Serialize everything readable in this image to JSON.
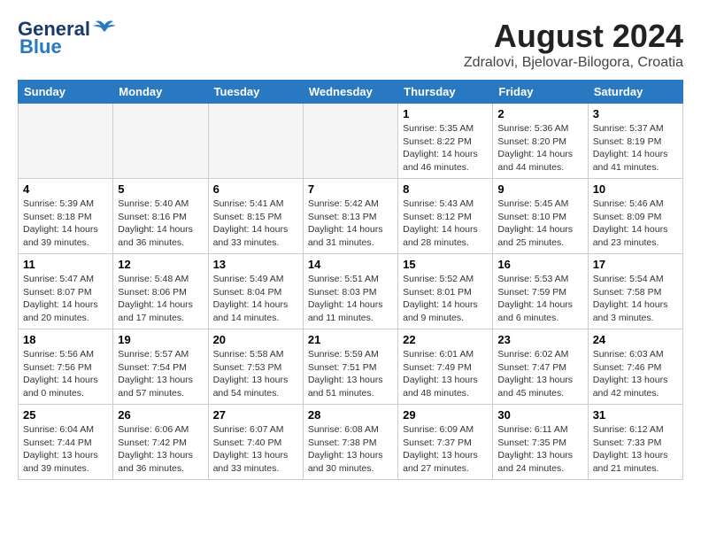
{
  "header": {
    "logo_general": "General",
    "logo_blue": "Blue",
    "month_year": "August 2024",
    "location": "Zdralovi, Bjelovar-Bilogora, Croatia"
  },
  "weekdays": [
    "Sunday",
    "Monday",
    "Tuesday",
    "Wednesday",
    "Thursday",
    "Friday",
    "Saturday"
  ],
  "weeks": [
    [
      {
        "day": "",
        "info": ""
      },
      {
        "day": "",
        "info": ""
      },
      {
        "day": "",
        "info": ""
      },
      {
        "day": "",
        "info": ""
      },
      {
        "day": "1",
        "info": "Sunrise: 5:35 AM\nSunset: 8:22 PM\nDaylight: 14 hours\nand 46 minutes."
      },
      {
        "day": "2",
        "info": "Sunrise: 5:36 AM\nSunset: 8:20 PM\nDaylight: 14 hours\nand 44 minutes."
      },
      {
        "day": "3",
        "info": "Sunrise: 5:37 AM\nSunset: 8:19 PM\nDaylight: 14 hours\nand 41 minutes."
      }
    ],
    [
      {
        "day": "4",
        "info": "Sunrise: 5:39 AM\nSunset: 8:18 PM\nDaylight: 14 hours\nand 39 minutes."
      },
      {
        "day": "5",
        "info": "Sunrise: 5:40 AM\nSunset: 8:16 PM\nDaylight: 14 hours\nand 36 minutes."
      },
      {
        "day": "6",
        "info": "Sunrise: 5:41 AM\nSunset: 8:15 PM\nDaylight: 14 hours\nand 33 minutes."
      },
      {
        "day": "7",
        "info": "Sunrise: 5:42 AM\nSunset: 8:13 PM\nDaylight: 14 hours\nand 31 minutes."
      },
      {
        "day": "8",
        "info": "Sunrise: 5:43 AM\nSunset: 8:12 PM\nDaylight: 14 hours\nand 28 minutes."
      },
      {
        "day": "9",
        "info": "Sunrise: 5:45 AM\nSunset: 8:10 PM\nDaylight: 14 hours\nand 25 minutes."
      },
      {
        "day": "10",
        "info": "Sunrise: 5:46 AM\nSunset: 8:09 PM\nDaylight: 14 hours\nand 23 minutes."
      }
    ],
    [
      {
        "day": "11",
        "info": "Sunrise: 5:47 AM\nSunset: 8:07 PM\nDaylight: 14 hours\nand 20 minutes."
      },
      {
        "day": "12",
        "info": "Sunrise: 5:48 AM\nSunset: 8:06 PM\nDaylight: 14 hours\nand 17 minutes."
      },
      {
        "day": "13",
        "info": "Sunrise: 5:49 AM\nSunset: 8:04 PM\nDaylight: 14 hours\nand 14 minutes."
      },
      {
        "day": "14",
        "info": "Sunrise: 5:51 AM\nSunset: 8:03 PM\nDaylight: 14 hours\nand 11 minutes."
      },
      {
        "day": "15",
        "info": "Sunrise: 5:52 AM\nSunset: 8:01 PM\nDaylight: 14 hours\nand 9 minutes."
      },
      {
        "day": "16",
        "info": "Sunrise: 5:53 AM\nSunset: 7:59 PM\nDaylight: 14 hours\nand 6 minutes."
      },
      {
        "day": "17",
        "info": "Sunrise: 5:54 AM\nSunset: 7:58 PM\nDaylight: 14 hours\nand 3 minutes."
      }
    ],
    [
      {
        "day": "18",
        "info": "Sunrise: 5:56 AM\nSunset: 7:56 PM\nDaylight: 14 hours\nand 0 minutes."
      },
      {
        "day": "19",
        "info": "Sunrise: 5:57 AM\nSunset: 7:54 PM\nDaylight: 13 hours\nand 57 minutes."
      },
      {
        "day": "20",
        "info": "Sunrise: 5:58 AM\nSunset: 7:53 PM\nDaylight: 13 hours\nand 54 minutes."
      },
      {
        "day": "21",
        "info": "Sunrise: 5:59 AM\nSunset: 7:51 PM\nDaylight: 13 hours\nand 51 minutes."
      },
      {
        "day": "22",
        "info": "Sunrise: 6:01 AM\nSunset: 7:49 PM\nDaylight: 13 hours\nand 48 minutes."
      },
      {
        "day": "23",
        "info": "Sunrise: 6:02 AM\nSunset: 7:47 PM\nDaylight: 13 hours\nand 45 minutes."
      },
      {
        "day": "24",
        "info": "Sunrise: 6:03 AM\nSunset: 7:46 PM\nDaylight: 13 hours\nand 42 minutes."
      }
    ],
    [
      {
        "day": "25",
        "info": "Sunrise: 6:04 AM\nSunset: 7:44 PM\nDaylight: 13 hours\nand 39 minutes."
      },
      {
        "day": "26",
        "info": "Sunrise: 6:06 AM\nSunset: 7:42 PM\nDaylight: 13 hours\nand 36 minutes."
      },
      {
        "day": "27",
        "info": "Sunrise: 6:07 AM\nSunset: 7:40 PM\nDaylight: 13 hours\nand 33 minutes."
      },
      {
        "day": "28",
        "info": "Sunrise: 6:08 AM\nSunset: 7:38 PM\nDaylight: 13 hours\nand 30 minutes."
      },
      {
        "day": "29",
        "info": "Sunrise: 6:09 AM\nSunset: 7:37 PM\nDaylight: 13 hours\nand 27 minutes."
      },
      {
        "day": "30",
        "info": "Sunrise: 6:11 AM\nSunset: 7:35 PM\nDaylight: 13 hours\nand 24 minutes."
      },
      {
        "day": "31",
        "info": "Sunrise: 6:12 AM\nSunset: 7:33 PM\nDaylight: 13 hours\nand 21 minutes."
      }
    ]
  ]
}
